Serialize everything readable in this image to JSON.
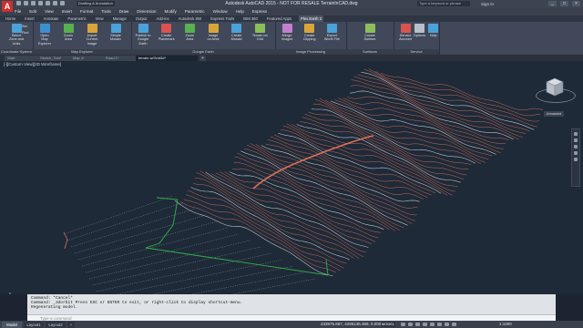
{
  "titlebar": {
    "app_logo": "A",
    "workspace": "Drafting & Annotation",
    "title": "Autodesk AutoCAD 2015 - NOT FOR RESALE   TerrainInCAD.dwg",
    "search_placeholder": "Type a keyword or phrase",
    "signin": "Sign In",
    "min": "_",
    "max": "□",
    "close": "×"
  },
  "menubar": [
    "File",
    "Edit",
    "View",
    "Insert",
    "Format",
    "Tools",
    "Draw",
    "Dimension",
    "Modify",
    "Parametric",
    "Window",
    "Help",
    "Express"
  ],
  "ribbon_tabs": [
    {
      "label": "Home",
      "active": false
    },
    {
      "label": "Insert",
      "active": false
    },
    {
      "label": "Annotate",
      "active": false
    },
    {
      "label": "Parametric",
      "active": false
    },
    {
      "label": "View",
      "active": false
    },
    {
      "label": "Manage",
      "active": false
    },
    {
      "label": "Output",
      "active": false
    },
    {
      "label": "Add-ins",
      "active": false
    },
    {
      "label": "Autodesk 360",
      "active": false
    },
    {
      "label": "Express Tools",
      "active": false
    },
    {
      "label": "BIM 360",
      "active": false
    },
    {
      "label": "Featured Apps",
      "active": false
    },
    {
      "label": "Plex.Earth 3",
      "active": true
    }
  ],
  "ribbon": {
    "panels": [
      {
        "title": "Coordinate System",
        "tools": [
          {
            "label": "Select\nZone and Units",
            "icon": "globe-icon",
            "color": "#4aa3d8"
          }
        ],
        "small": [
          "Set",
          "Find"
        ]
      },
      {
        "title": "Map Explorer",
        "tools": [
          {
            "label": "Open\nMap Explorer",
            "icon": "map-explorer-icon",
            "color": "#3d8fd0"
          },
          {
            "label": "Zoom\nArea",
            "icon": "zoom-area-icon",
            "color": "#58b04e"
          },
          {
            "label": "Import\nCurrent Image",
            "icon": "import-image-icon",
            "color": "#d9a53a"
          },
          {
            "label": "Simple\nMosaic",
            "icon": "mosaic-icon",
            "color": "#4aa3d8"
          }
        ]
      },
      {
        "title": "Google Earth",
        "tools": [
          {
            "label": "Publish to\nGoogle Earth",
            "icon": "publish-earth-icon",
            "color": "#4aa3d8"
          },
          {
            "label": "Create\nPlacemark",
            "icon": "placemark-icon",
            "color": "#d9534f"
          },
          {
            "label": "Zoom\nArea",
            "icon": "zoom-area-2-icon",
            "color": "#58b04e"
          },
          {
            "label": "Image\non Area",
            "icon": "image-area-icon",
            "color": "#d9a53a"
          },
          {
            "label": "Create\nMosaic",
            "icon": "create-mosaic-icon",
            "color": "#4aa3d8"
          },
          {
            "label": "Terrain on\nGrid",
            "icon": "terrain-grid-icon",
            "color": "#8bbf5a"
          }
        ]
      },
      {
        "title": "Image Processing",
        "tools": [
          {
            "label": "Merge\nImages",
            "icon": "merge-images-icon",
            "color": "#c27fd0"
          },
          {
            "label": "Create\nClipping",
            "icon": "clipping-icon",
            "color": "#d9a53a"
          },
          {
            "label": "Export\nWorld File",
            "icon": "world-file-icon",
            "color": "#4aa3d8"
          }
        ]
      },
      {
        "title": "Surfaces",
        "tools": [
          {
            "label": "Create\nSurface",
            "icon": "surface-icon",
            "color": "#8bbf5a"
          }
        ]
      },
      {
        "title": "Service",
        "tools": [
          {
            "label": "Service\nAccount",
            "icon": "account-icon",
            "color": "#d9534f"
          },
          {
            "label": "Options",
            "icon": "wrench-icon",
            "color": "#b8c0cc"
          },
          {
            "label": "Help",
            "icon": "help-icon",
            "color": "#4aa3d8"
          }
        ]
      }
    ]
  },
  "document_tabs": [
    {
      "label": "Start",
      "active": false
    },
    {
      "label": "Sketch_Test*",
      "active": false
    },
    {
      "label": "Map 4*",
      "active": false
    },
    {
      "label": "Road 1*",
      "active": false
    },
    {
      "label": "terrain w/Grid3d*",
      "active": true
    }
  ],
  "new_tab": "+",
  "viewport": {
    "label": "[-][Custom View][2D Wireframe]",
    "wcs": "Unnamed",
    "colors": {
      "contour_major": "#d9705a",
      "contour_minor": "#cfd6d8",
      "boundary": "#2fb34a",
      "road": "#d9705a",
      "background": "#1f2a38"
    }
  },
  "command": {
    "history": [
      "Command: *Cancel*",
      "Command: _3dorbit Press ESC or ENTER to exit, or right-click to display shortcut-menu.",
      "Regenerating model."
    ],
    "placeholder": "Type a command"
  },
  "status": {
    "tabs": [
      {
        "label": "Model",
        "active": true
      },
      {
        "label": "Layout1",
        "active": false
      },
      {
        "label": "Layout2",
        "active": false
      },
      {
        "label": "+",
        "active": false
      }
    ],
    "coordinates": "233575.667, 4296136.369, 0.0000",
    "model": "MODEL",
    "scale": "1:1000"
  }
}
